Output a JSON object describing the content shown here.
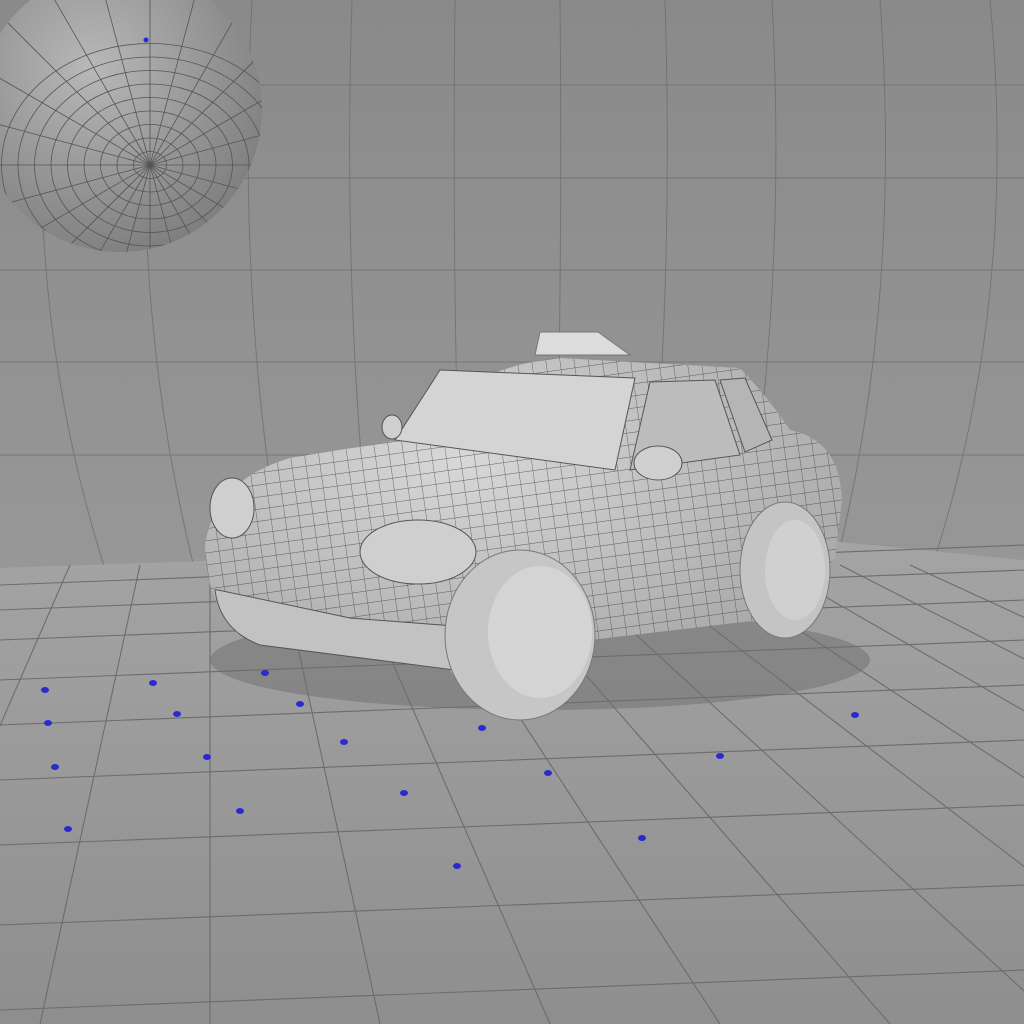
{
  "scene": {
    "description_type": "3d-wireframe-viewport-render",
    "colors": {
      "wall": "#8e8e8e",
      "floor": "#9a9a9a",
      "grid_line": "#6f6f6f",
      "car_body": "#c9c9c9",
      "wire": "#3a3a3a",
      "vertex_marker": "#2a2ad0",
      "sphere": "#a8a8a8"
    },
    "objects": [
      "sphere",
      "taxi-car",
      "floor-grid",
      "backdrop-wall"
    ],
    "vertex_marker_count": 22
  }
}
